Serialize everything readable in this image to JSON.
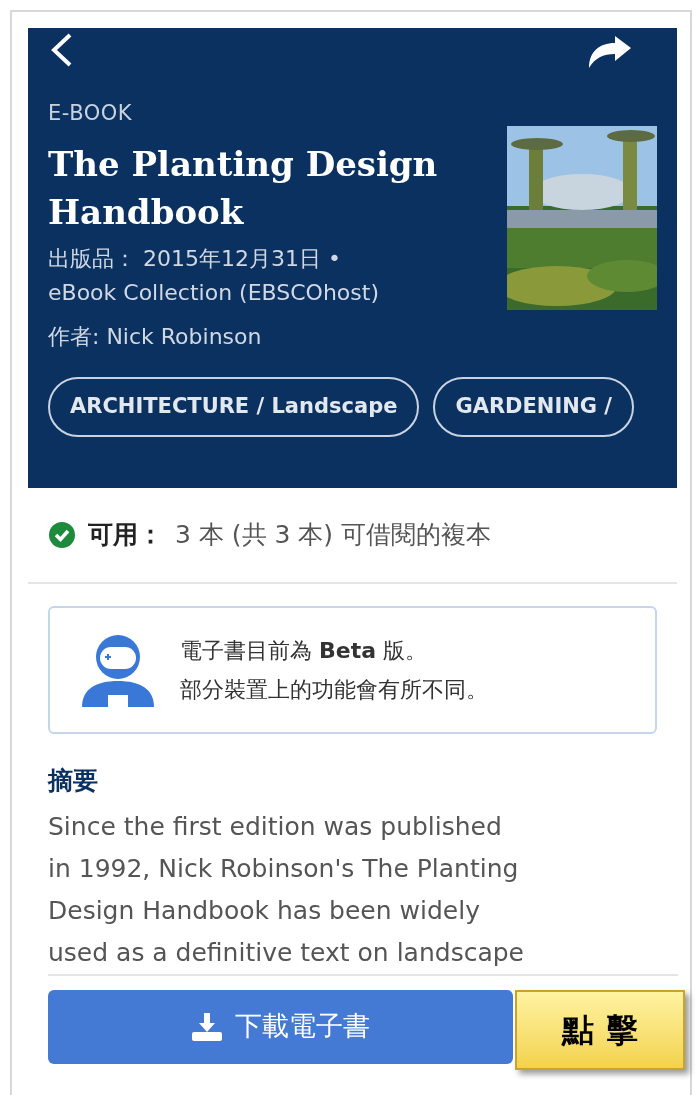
{
  "header": {
    "type_label": "E-BOOK",
    "title": "The Planting Design Handbook",
    "meta_lines": [
      "出版品： 2015年12月31日 •",
      "eBook Collection (EBSCOhost)"
    ],
    "author": "作者: Nick Robinson",
    "tags": [
      "ARCHITECTURE / Landscape",
      "GARDENING /"
    ]
  },
  "availability": {
    "available": true,
    "label": "可用：",
    "text": "3 本 (共 3 本) 可借閱的複本"
  },
  "notice": {
    "lines": [
      "電子書目前為 **Beta** 版。",
      "部分裝置上的功能會有所不同。"
    ]
  },
  "summary": {
    "heading": "摘要",
    "lines": [
      "Since the first edition was published",
      "in 1992, Nick Robinson's The Planting",
      "Design Handbook has been widely",
      "used as a definitive text on landscape"
    ]
  },
  "download_button": {
    "label": "下載電子書"
  },
  "callout": {
    "label": "點 擊"
  }
}
